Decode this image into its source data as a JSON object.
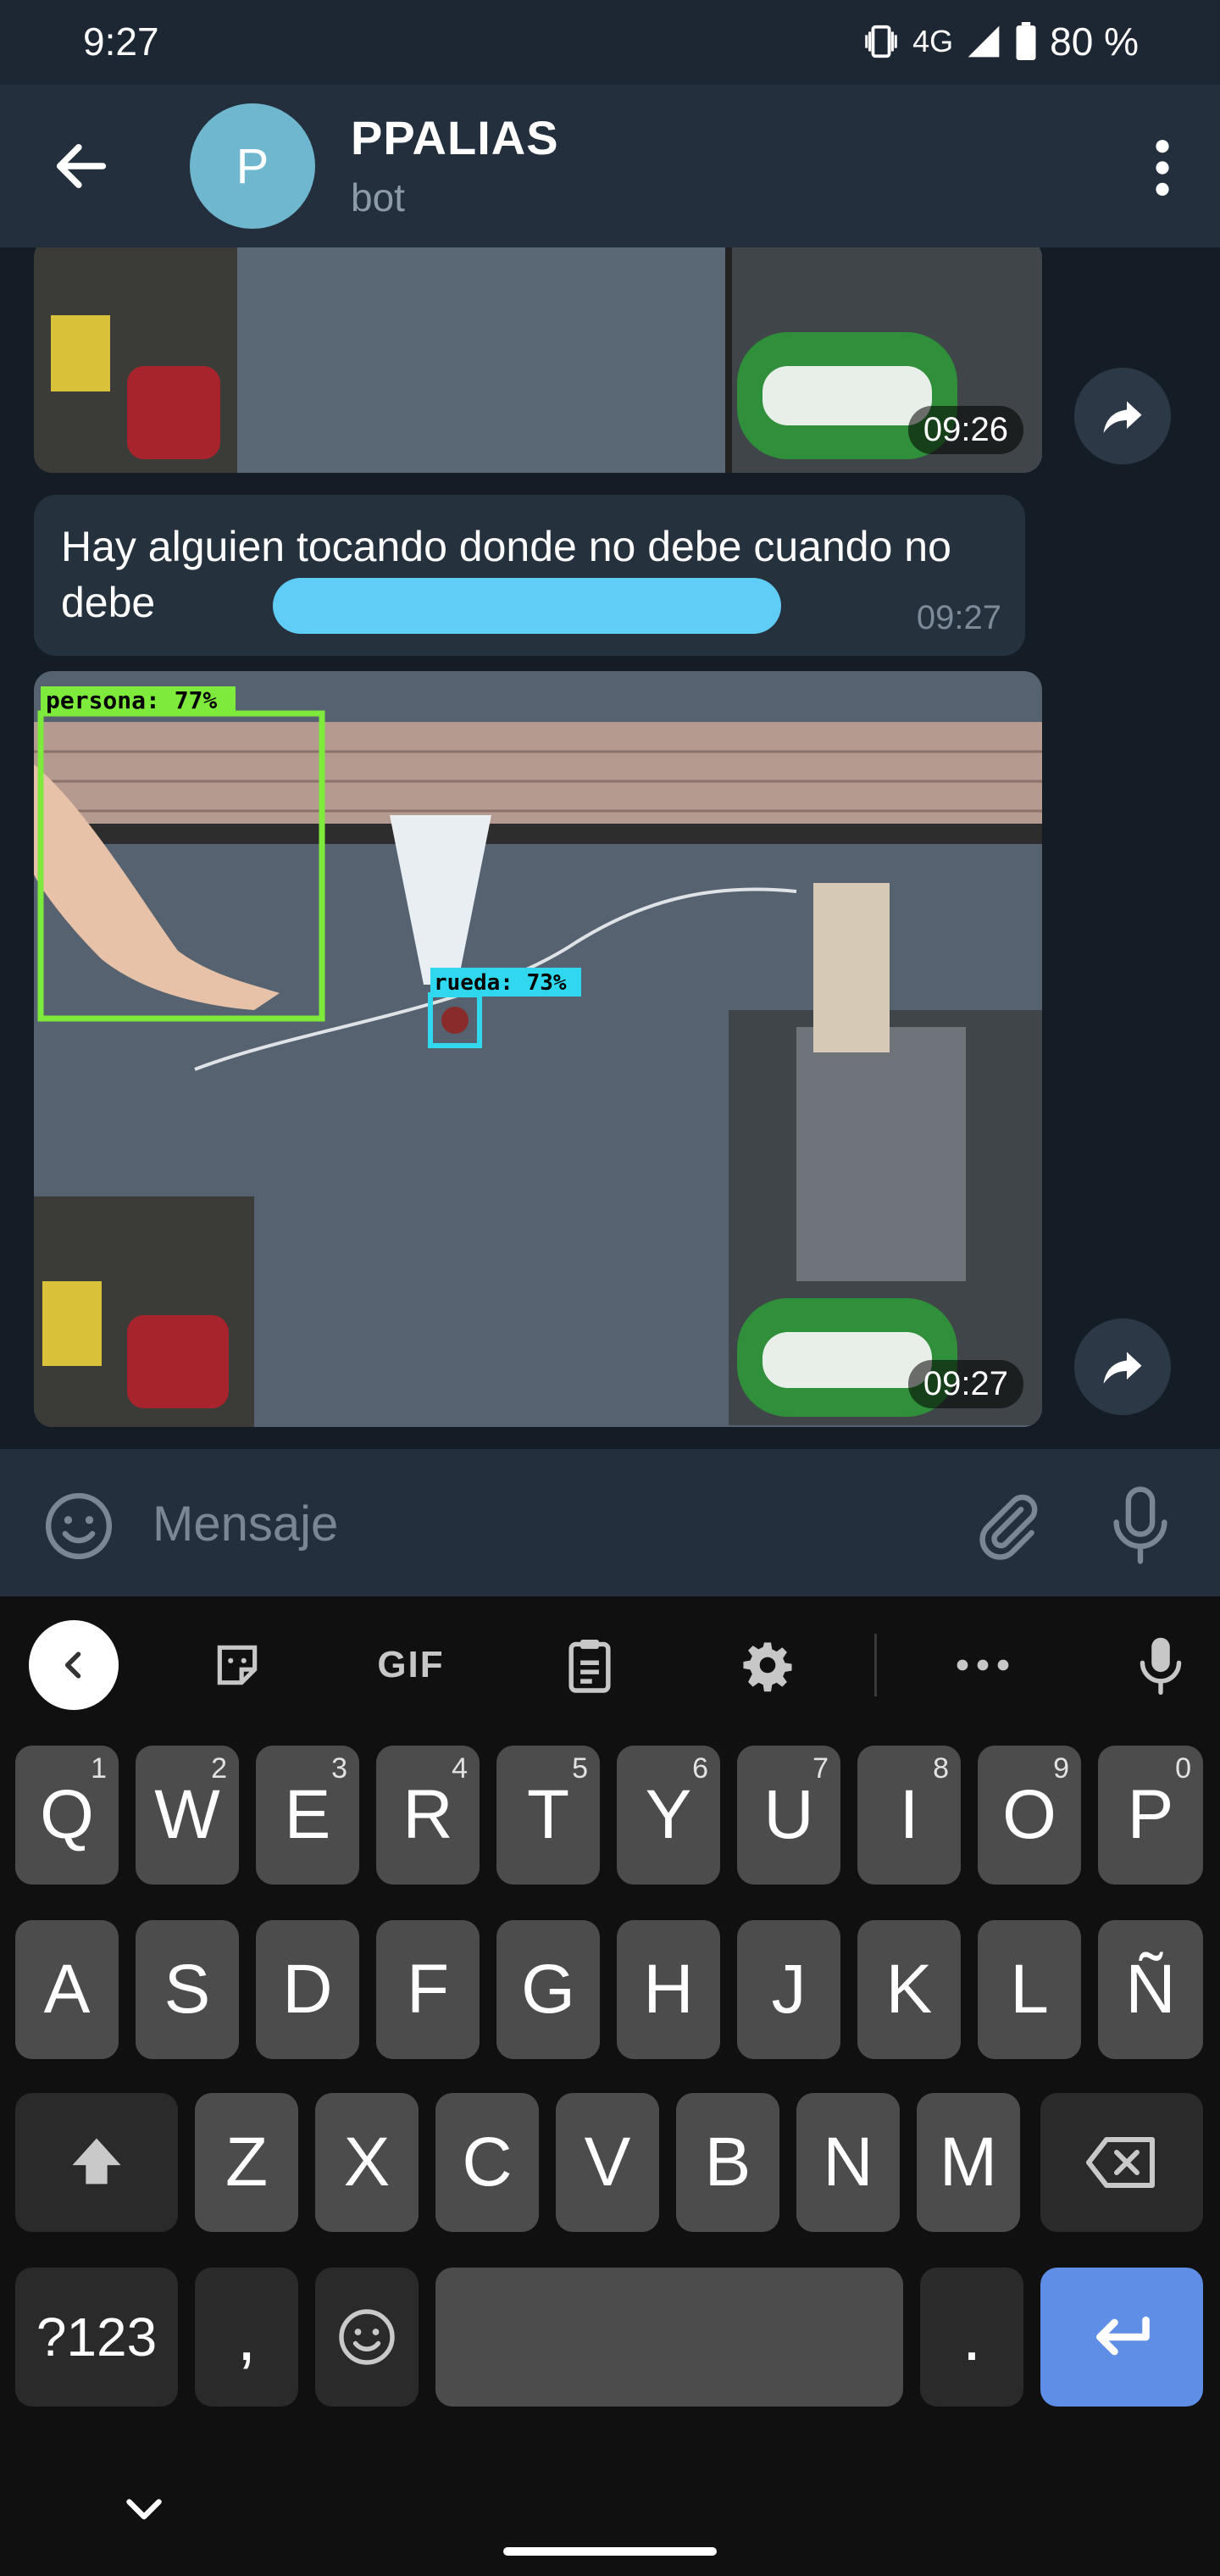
{
  "status_bar": {
    "time": "9:27",
    "network": "4G",
    "battery": "80 %"
  },
  "header": {
    "avatar_letter": "P",
    "title": "PPALIAS",
    "subtitle": "bot"
  },
  "messages": {
    "photo1_time": "09:26",
    "text_body": "Hay alguien tocando donde no debe cuando no debe",
    "text_time": "09:27",
    "photo2_time": "09:27",
    "photo2_labels": {
      "person": "persona: 77%",
      "wheel": "rueda: 73%"
    }
  },
  "composer": {
    "placeholder": "Mensaje"
  },
  "keyboard": {
    "toolbar_gif": "GIF",
    "row1": [
      {
        "k": "Q",
        "h": "1"
      },
      {
        "k": "W",
        "h": "2"
      },
      {
        "k": "E",
        "h": "3"
      },
      {
        "k": "R",
        "h": "4"
      },
      {
        "k": "T",
        "h": "5"
      },
      {
        "k": "Y",
        "h": "6"
      },
      {
        "k": "U",
        "h": "7"
      },
      {
        "k": "I",
        "h": "8"
      },
      {
        "k": "O",
        "h": "9"
      },
      {
        "k": "P",
        "h": "0"
      }
    ],
    "row2": [
      "A",
      "S",
      "D",
      "F",
      "G",
      "H",
      "J",
      "K",
      "L",
      "Ñ"
    ],
    "row3": [
      "Z",
      "X",
      "C",
      "V",
      "B",
      "N",
      "M"
    ],
    "symbols": "?123",
    "comma": ",",
    "period": "."
  },
  "colors": {
    "accent": "#5e8ee6",
    "header": "#232f3d",
    "avatar": "#6fb7cf",
    "redaction": "#5fcdf5"
  }
}
